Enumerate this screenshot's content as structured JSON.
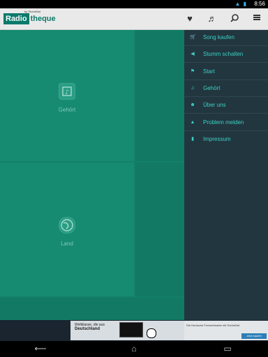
{
  "status": {
    "time": "8:56"
  },
  "header": {
    "logo_main": "Radio",
    "logo_suffix": "theque",
    "logo_small": "by TechniSat"
  },
  "content": {
    "tiles": [
      {
        "label": "Gehört",
        "icon": "music-book-icon"
      },
      {
        "label": "Land",
        "icon": "globe-icon"
      }
    ]
  },
  "menu": {
    "items": [
      {
        "label": "Song kaufen",
        "icon": "shopping-cart-icon"
      },
      {
        "label": "Stumm schalten",
        "icon": "speaker-mute-icon"
      },
      {
        "label": "Start",
        "icon": "flag-icon"
      },
      {
        "label": "Gehört",
        "icon": "music-book-icon"
      },
      {
        "label": "Über uns",
        "icon": "info-icon"
      },
      {
        "label": "Problem melden",
        "icon": "warning-icon"
      },
      {
        "label": "Impressum",
        "icon": "document-icon"
      }
    ]
  },
  "ad": {
    "line1": "Weltklasse, die aus",
    "line2": "Deutschland",
    "right_text": "Die Deutsche Fernsehmarke mit TechniSat",
    "right_button": "Jetzt kaufen"
  },
  "colors": {
    "accent": "#3bd1c4",
    "drawer_bg": "#22363f",
    "content_bg": "#14806a"
  }
}
